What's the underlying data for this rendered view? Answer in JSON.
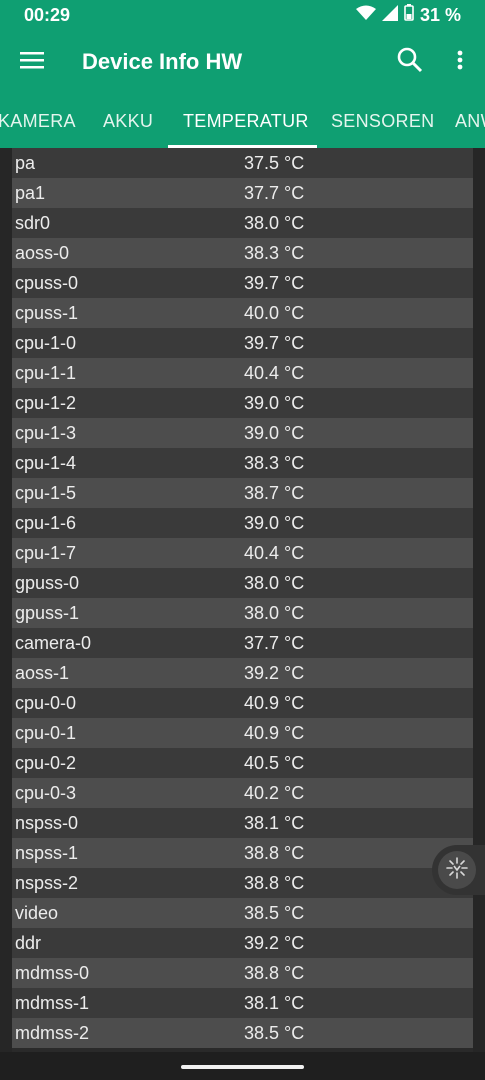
{
  "status": {
    "time": "00:29",
    "battery": "31 %"
  },
  "appbar": {
    "title": "Device Info HW"
  },
  "icons": {
    "menu": "menu-icon",
    "search": "search-icon",
    "more": "more-vert-icon"
  },
  "tabs": [
    {
      "label": "KAMERA"
    },
    {
      "label": "AKKU"
    },
    {
      "label": "TEMPERATUR",
      "active": true
    },
    {
      "label": "SENSOREN"
    },
    {
      "label": "ANW"
    }
  ],
  "rows": [
    {
      "name": "pa",
      "value": "37.5 °C"
    },
    {
      "name": "pa1",
      "value": "37.7 °C"
    },
    {
      "name": "sdr0",
      "value": "38.0 °C"
    },
    {
      "name": "aoss-0",
      "value": "38.3 °C"
    },
    {
      "name": "cpuss-0",
      "value": "39.7 °C"
    },
    {
      "name": "cpuss-1",
      "value": "40.0 °C"
    },
    {
      "name": "cpu-1-0",
      "value": "39.7 °C"
    },
    {
      "name": "cpu-1-1",
      "value": "40.4 °C"
    },
    {
      "name": "cpu-1-2",
      "value": "39.0 °C"
    },
    {
      "name": "cpu-1-3",
      "value": "39.0 °C"
    },
    {
      "name": "cpu-1-4",
      "value": "38.3 °C"
    },
    {
      "name": "cpu-1-5",
      "value": "38.7 °C"
    },
    {
      "name": "cpu-1-6",
      "value": "39.0 °C"
    },
    {
      "name": "cpu-1-7",
      "value": "40.4 °C"
    },
    {
      "name": "gpuss-0",
      "value": "38.0 °C"
    },
    {
      "name": "gpuss-1",
      "value": "38.0 °C"
    },
    {
      "name": "camera-0",
      "value": "37.7 °C"
    },
    {
      "name": "aoss-1",
      "value": "39.2 °C"
    },
    {
      "name": "cpu-0-0",
      "value": "40.9 °C"
    },
    {
      "name": "cpu-0-1",
      "value": "40.9 °C"
    },
    {
      "name": "cpu-0-2",
      "value": "40.5 °C"
    },
    {
      "name": "cpu-0-3",
      "value": "40.2 °C"
    },
    {
      "name": "nspss-0",
      "value": "38.1 °C"
    },
    {
      "name": "nspss-1",
      "value": "38.8 °C"
    },
    {
      "name": "nspss-2",
      "value": "38.8 °C"
    },
    {
      "name": "video",
      "value": "38.5 °C"
    },
    {
      "name": "ddr",
      "value": "39.2 °C"
    },
    {
      "name": "mdmss-0",
      "value": "38.8 °C"
    },
    {
      "name": "mdmss-1",
      "value": "38.1 °C"
    },
    {
      "name": "mdmss-2",
      "value": "38.5 °C"
    }
  ],
  "colors": {
    "accent": "#0f9f72",
    "row_odd": "#3a3a3a",
    "row_even": "#4d4d4d"
  }
}
